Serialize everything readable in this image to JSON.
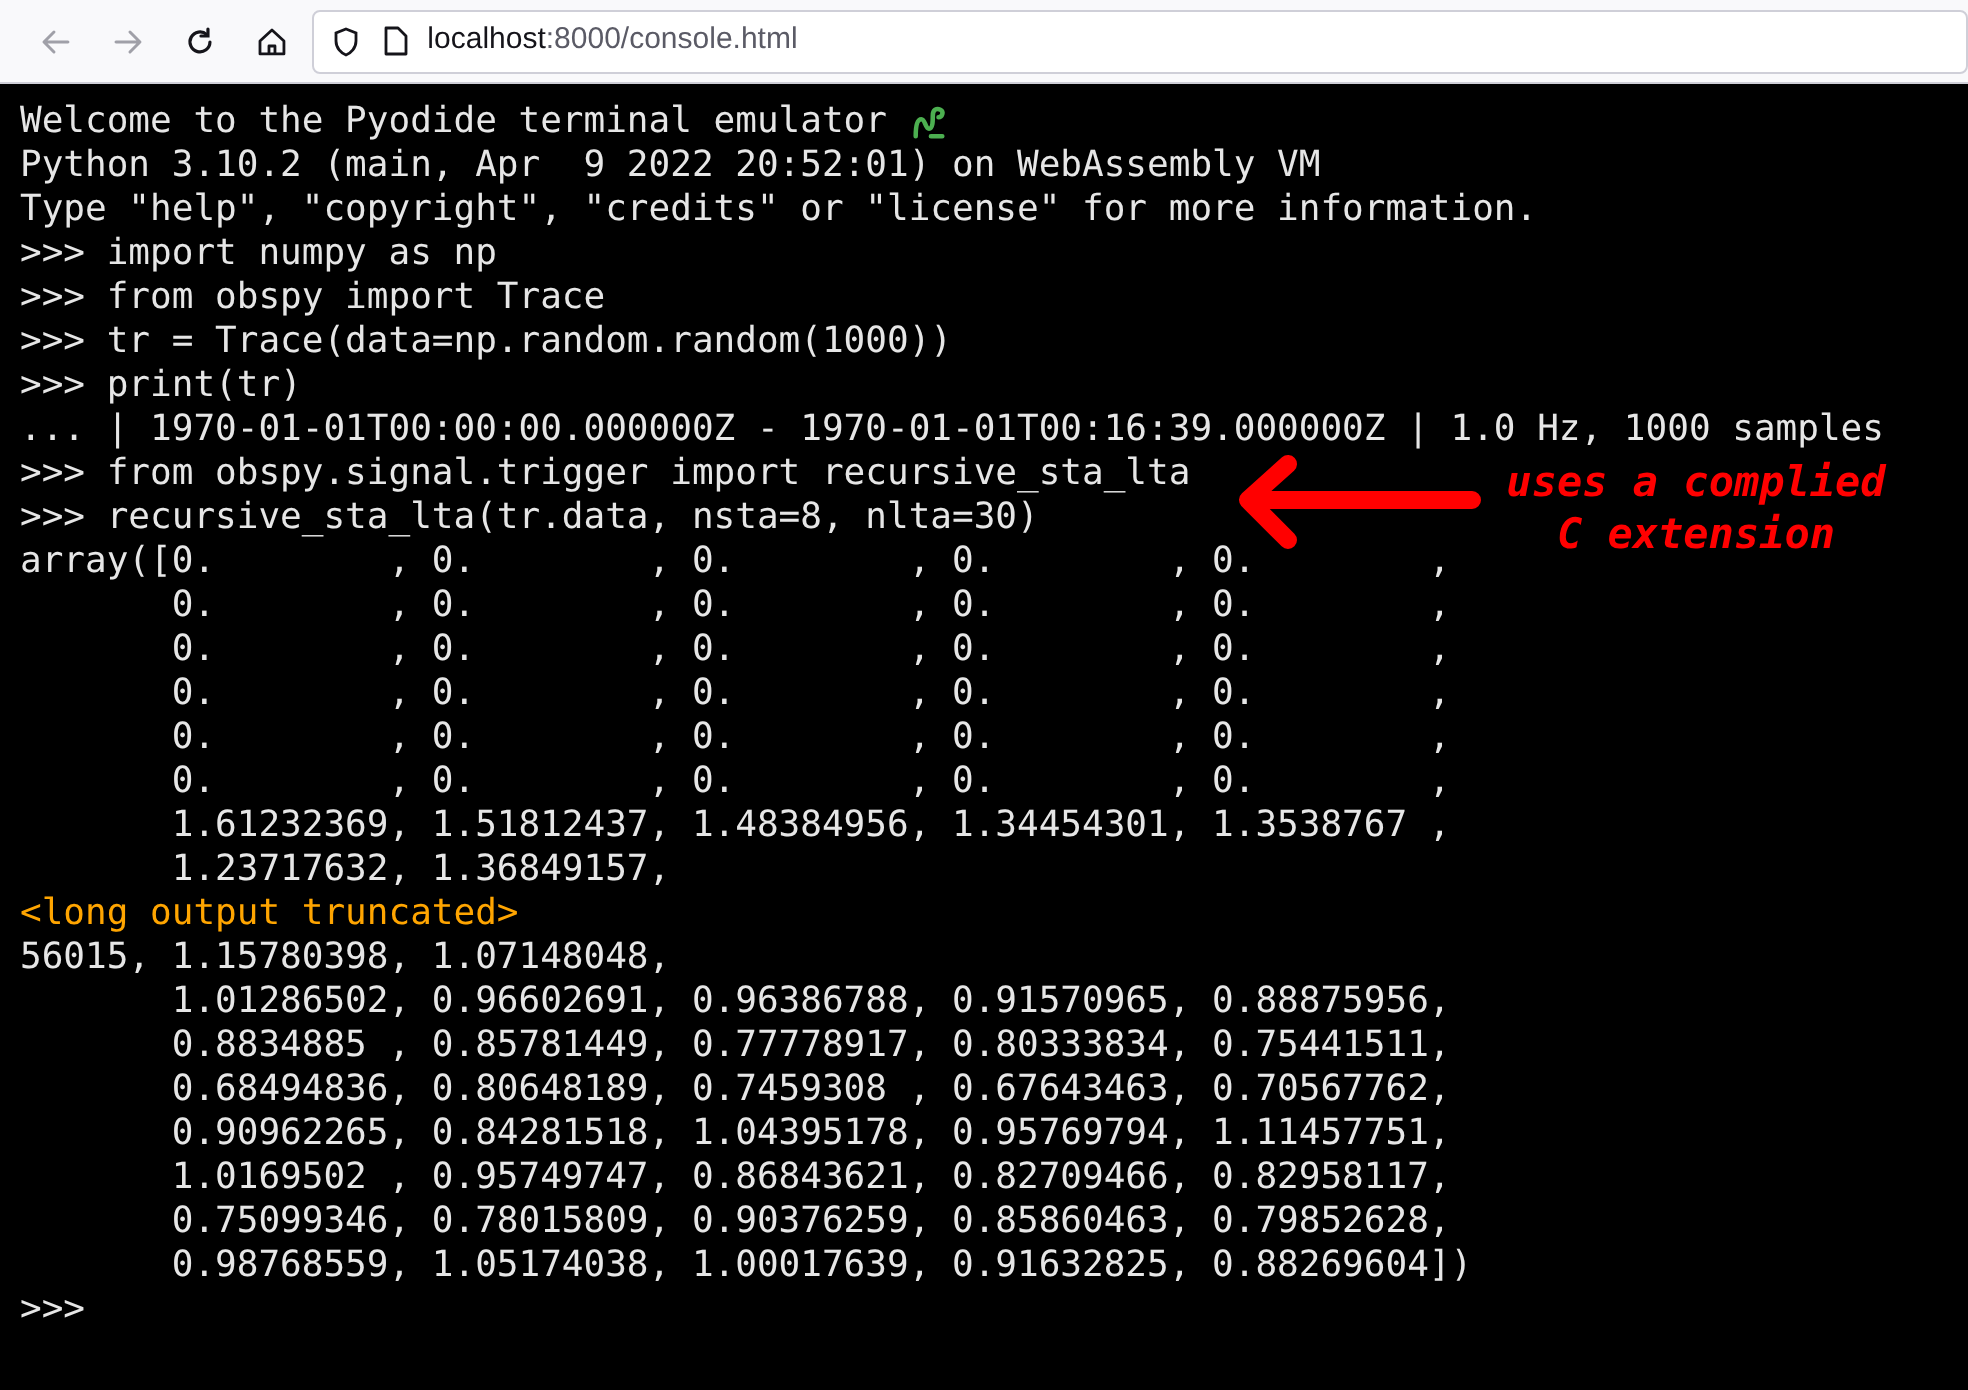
{
  "browser": {
    "back_disabled": true,
    "forward_disabled": true,
    "url_host": "localhost",
    "url_path": ":8000/console.html"
  },
  "terminal": {
    "lines": [
      {
        "kind": "output",
        "text": "Welcome to the Pyodide terminal emulator",
        "snake": true
      },
      {
        "kind": "output",
        "text": "Python 3.10.2 (main, Apr  9 2022 20:52:01) on WebAssembly VM"
      },
      {
        "kind": "output",
        "text": "Type \"help\", \"copyright\", \"credits\" or \"license\" for more information."
      },
      {
        "kind": "input",
        "text": ">>> import numpy as np"
      },
      {
        "kind": "input",
        "text": ">>> from obspy import Trace"
      },
      {
        "kind": "input",
        "text": ">>> tr = Trace(data=np.random.random(1000))"
      },
      {
        "kind": "input",
        "text": ">>> print(tr)"
      },
      {
        "kind": "output",
        "text": "... | 1970-01-01T00:00:00.000000Z - 1970-01-01T00:16:39.000000Z | 1.0 Hz, 1000 samples"
      },
      {
        "kind": "input",
        "text": ">>> from obspy.signal.trigger import recursive_sta_lta"
      },
      {
        "kind": "input",
        "text": ">>> recursive_sta_lta(tr.data, nsta=8, nlta=30)"
      },
      {
        "kind": "output",
        "text": "array([0.        , 0.        , 0.        , 0.        , 0.        ,"
      },
      {
        "kind": "output",
        "text": "       0.        , 0.        , 0.        , 0.        , 0.        ,"
      },
      {
        "kind": "output",
        "text": "       0.        , 0.        , 0.        , 0.        , 0.        ,"
      },
      {
        "kind": "output",
        "text": "       0.        , 0.        , 0.        , 0.        , 0.        ,"
      },
      {
        "kind": "output",
        "text": "       0.        , 0.        , 0.        , 0.        , 0.        ,"
      },
      {
        "kind": "output",
        "text": "       0.        , 0.        , 0.        , 0.        , 0.        ,"
      },
      {
        "kind": "output",
        "text": "       1.61232369, 1.51812437, 1.48384956, 1.34454301, 1.3538767 ,"
      },
      {
        "kind": "output",
        "text": "       1.23717632, 1.36849157,"
      },
      {
        "kind": "notice",
        "text": "<long output truncated>"
      },
      {
        "kind": "output",
        "text": "56015, 1.15780398, 1.07148048,"
      },
      {
        "kind": "output",
        "text": "       1.01286502, 0.96602691, 0.96386788, 0.91570965, 0.88875956,"
      },
      {
        "kind": "output",
        "text": "       0.8834885 , 0.85781449, 0.77778917, 0.80333834, 0.75441511,"
      },
      {
        "kind": "output",
        "text": "       0.68494836, 0.80648189, 0.7459308 , 0.67643463, 0.70567762,"
      },
      {
        "kind": "output",
        "text": "       0.90962265, 0.84281518, 1.04395178, 0.95769794, 1.11457751,"
      },
      {
        "kind": "output",
        "text": "       1.0169502 , 0.95749747, 0.86843621, 0.82709466, 0.82958117,"
      },
      {
        "kind": "output",
        "text": "       0.75099346, 0.78015809, 0.90376259, 0.85860463, 0.79852628,"
      },
      {
        "kind": "output",
        "text": "       0.98768559, 1.05174038, 1.00017639, 0.91632825, 0.88269604])"
      },
      {
        "kind": "input",
        "text": ">>>"
      }
    ]
  },
  "annotation": {
    "lines": [
      "uses a complied",
      "C extension"
    ]
  }
}
